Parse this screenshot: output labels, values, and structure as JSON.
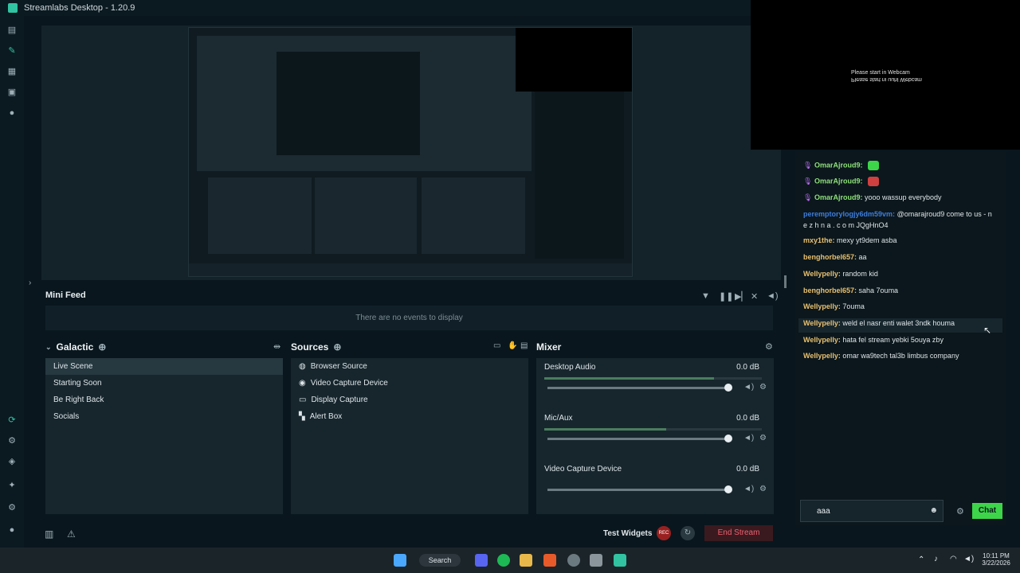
{
  "window": {
    "title": "Streamlabs Desktop - 1.20.9"
  },
  "leftnav": {
    "icons": [
      "dashboard-icon",
      "editor-icon",
      "store-icon",
      "layout-icon",
      "record-icon"
    ]
  },
  "minifeed": {
    "title": "Mini Feed",
    "empty_text": "There are no events to display"
  },
  "scenes": {
    "title": "Galactic",
    "items": [
      "Live Scene",
      "Starting Soon",
      "Be Right Back",
      "Socials"
    ]
  },
  "sources": {
    "title": "Sources",
    "items": [
      "Browser Source",
      "Video Capture Device",
      "Display Capture",
      "Alert Box"
    ]
  },
  "mixer": {
    "title": "Mixer",
    "channels": [
      {
        "name": "Desktop Audio",
        "db": "0.0 dB",
        "level": 0.97
      },
      {
        "name": "Mic/Aux",
        "db": "0.0 dB",
        "level": 0.97
      },
      {
        "name": "Video Capture Device",
        "db": "0.0 dB",
        "level": 0.97
      }
    ]
  },
  "footer": {
    "test_widgets": "Test Widgets",
    "rec": "REC",
    "end_stream": "End Stream"
  },
  "webcam": {
    "text": "Please start in Webcam",
    "mirror": "Please start ni uuhl Webcam"
  },
  "chat": {
    "messages": [
      {
        "user": "OmarAjroud9:",
        "text": "",
        "color": "#8ee07a"
      },
      {
        "user": "OmarAjroud9:",
        "text": "",
        "color": "#8ee07a"
      },
      {
        "user": "OmarAjroud9:",
        "text": "yooo wassup everybody",
        "color": "#8ee07a"
      },
      {
        "user": "peremptorylogjy6dm59vm:",
        "text": "@omarajroud9 come to us - n",
        "color": "#3d7de0"
      },
      {
        "user": "",
        "text": "e z h n a . c o m JQgHnO4",
        "color": "#3d7de0"
      },
      {
        "user": "mxy1the:",
        "text": "mexy yt9dem asba",
        "color": "#e8c070"
      },
      {
        "user": "benghorbel657:",
        "text": "aa",
        "color": "#e8c070"
      },
      {
        "user": "Wellypelly:",
        "text": "random kid",
        "color": "#e8c070"
      },
      {
        "user": "benghorbel657:",
        "text": "saha 7ouma",
        "color": "#e8c070"
      },
      {
        "user": "Wellypelly:",
        "text": "7ouma",
        "color": "#e8c070"
      },
      {
        "user": "Wellypelly:",
        "text": "weld el nasr enti walet 3ndk houma",
        "color": "#e8c070"
      },
      {
        "user": "Wellypelly:",
        "text": "hata fel stream yebki 5ouya zby",
        "color": "#e8c070"
      },
      {
        "user": "Wellypelly:",
        "text": "omar wa9tech tal3b limbus company",
        "color": "#e8c070"
      }
    ],
    "input_value": "aaa",
    "chat_button": "Chat"
  },
  "taskbar": {
    "search": "Search",
    "time": "10:11 PM",
    "date": "3/22/2026"
  }
}
